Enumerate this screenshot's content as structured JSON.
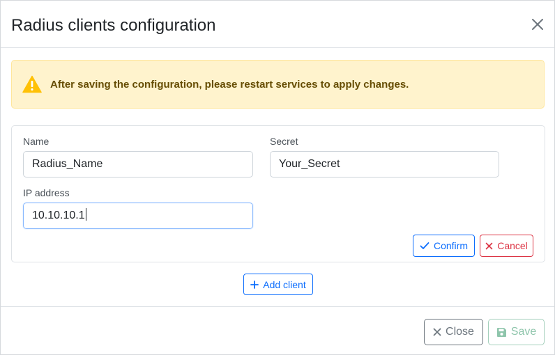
{
  "modal": {
    "title": "Radius clients configuration"
  },
  "alert": {
    "text": "After saving the configuration, please restart services to apply changes."
  },
  "form": {
    "name_label": "Name",
    "name_value": "Radius_Name",
    "secret_label": "Secret",
    "secret_value": "Your_Secret",
    "ip_label": "IP address",
    "ip_value": "10.10.10.1"
  },
  "actions": {
    "confirm_label": "Confirm",
    "cancel_label": "Cancel",
    "add_client_label": "Add client"
  },
  "footer": {
    "close_label": "Close",
    "save_label": "Save"
  },
  "colors": {
    "primary": "#0d6efd",
    "danger": "#dc3545",
    "warning_bg": "#fff3cd",
    "warning_icon": "#ffc107",
    "success_disabled": "#8ec5ab"
  }
}
